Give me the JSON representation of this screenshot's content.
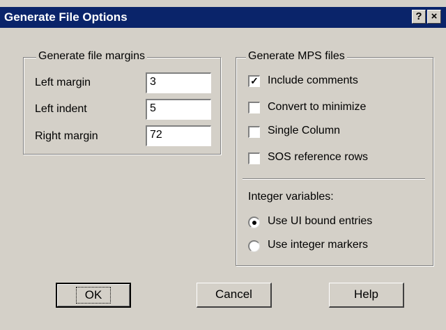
{
  "window": {
    "title": "Generate File Options",
    "help_glyph": "?",
    "close_glyph": "×"
  },
  "margins_group": {
    "legend": "Generate file margins",
    "fields": [
      {
        "label": "Left margin",
        "value": "3"
      },
      {
        "label": "Left indent",
        "value": "5"
      },
      {
        "label": "Right margin",
        "value": "72"
      }
    ]
  },
  "mps_group": {
    "legend": "Generate MPS files",
    "checkboxes": [
      {
        "label": "Include comments",
        "checked": true
      },
      {
        "label": "Convert to minimize",
        "checked": false
      },
      {
        "label": "Single Column",
        "checked": false
      },
      {
        "label": "SOS reference rows",
        "checked": false
      }
    ],
    "integer_label": "Integer variables:",
    "radios": [
      {
        "label": "Use UI bound entries",
        "selected": true
      },
      {
        "label": "Use integer markers",
        "selected": false
      }
    ]
  },
  "buttons": {
    "ok": "OK",
    "cancel": "Cancel",
    "help": "Help"
  }
}
